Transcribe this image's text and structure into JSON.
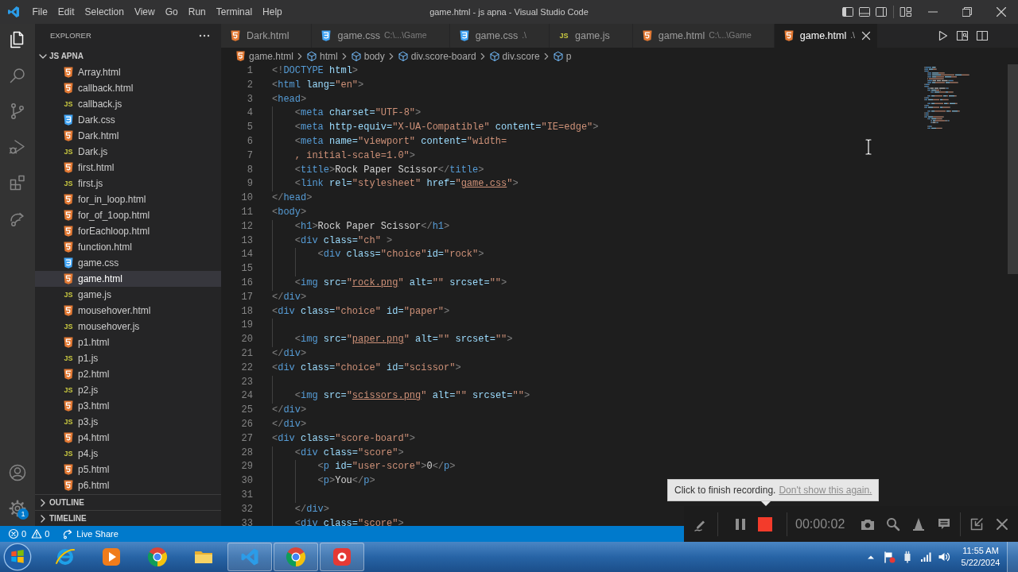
{
  "title_bar": {
    "menu": [
      "File",
      "Edit",
      "Selection",
      "View",
      "Go",
      "Run",
      "Terminal",
      "Help"
    ],
    "title": "game.html - js apna - Visual Studio Code"
  },
  "activity_bar": {
    "items": [
      {
        "kind": "explorer",
        "selected": true
      },
      {
        "kind": "search",
        "selected": false
      },
      {
        "kind": "source_control",
        "selected": false
      },
      {
        "kind": "run_debug",
        "selected": false
      },
      {
        "kind": "extensions",
        "selected": false
      },
      {
        "kind": "live_share",
        "selected": false
      }
    ],
    "bottom_items": [
      {
        "kind": "accounts"
      },
      {
        "kind": "manage",
        "badge": "1"
      }
    ]
  },
  "sidebar": {
    "title": "EXPLORER",
    "folder": {
      "name": "JS APNA",
      "expanded": true,
      "files": [
        {
          "kind": "html",
          "label": "Array.html",
          "selected": false
        },
        {
          "kind": "html",
          "label": "callback.html",
          "selected": false
        },
        {
          "kind": "js",
          "icon_text": "JS",
          "label": "callback.js",
          "selected": false
        },
        {
          "kind": "css",
          "label": "Dark.css",
          "selected": false
        },
        {
          "kind": "html",
          "label": "Dark.html",
          "selected": false
        },
        {
          "kind": "js",
          "icon_text": "JS",
          "label": "Dark.js",
          "selected": false
        },
        {
          "kind": "html",
          "label": "first.html",
          "selected": false
        },
        {
          "kind": "js",
          "icon_text": "JS",
          "label": "first.js",
          "selected": false
        },
        {
          "kind": "html",
          "label": "for_in_loop.html",
          "selected": false
        },
        {
          "kind": "html",
          "label": "for_of_1oop.html",
          "selected": false
        },
        {
          "kind": "html",
          "label": "forEachloop.html",
          "selected": false
        },
        {
          "kind": "html",
          "label": "function.html",
          "selected": false
        },
        {
          "kind": "css",
          "label": "game.css",
          "selected": false
        },
        {
          "kind": "html",
          "label": "game.html",
          "selected": true
        },
        {
          "kind": "js",
          "icon_text": "JS",
          "label": "game.js",
          "selected": false
        },
        {
          "kind": "html",
          "label": "mousehover.html",
          "selected": false
        },
        {
          "kind": "js",
          "icon_text": "JS",
          "label": "mousehover.js",
          "selected": false
        },
        {
          "kind": "html",
          "label": "p1.html",
          "selected": false
        },
        {
          "kind": "js",
          "icon_text": "JS",
          "label": "p1.js",
          "selected": false
        },
        {
          "kind": "html",
          "label": "p2.html",
          "selected": false
        },
        {
          "kind": "js",
          "icon_text": "JS",
          "label": "p2.js",
          "selected": false
        },
        {
          "kind": "html",
          "label": "p3.html",
          "selected": false
        },
        {
          "kind": "js",
          "icon_text": "JS",
          "label": "p3.js",
          "selected": false
        },
        {
          "kind": "html",
          "label": "p4.html",
          "selected": false
        },
        {
          "kind": "js",
          "icon_text": "JS",
          "label": "p4.js",
          "selected": false
        },
        {
          "kind": "html",
          "label": "p5.html",
          "selected": false
        },
        {
          "kind": "html",
          "label": "p6.html",
          "selected": false
        }
      ]
    },
    "panels": [
      {
        "name": "OUTLINE",
        "expanded": false
      },
      {
        "name": "TIMELINE",
        "expanded": false
      }
    ]
  },
  "tabs": [
    {
      "kind": "html",
      "label": "Dark.html",
      "selected": false
    },
    {
      "kind": "css",
      "label": "game.css",
      "description": "C:\\...\\Game",
      "selected": false
    },
    {
      "kind": "css",
      "label": "game.css",
      "description": ".\\",
      "selected": false
    },
    {
      "kind": "js",
      "icon_text": "JS",
      "label": "game.js",
      "selected": false
    },
    {
      "kind": "html",
      "label": "game.html",
      "description": "C:\\...\\Game",
      "selected": false
    },
    {
      "kind": "html",
      "label": "game.html",
      "description": ".\\",
      "selected": true
    }
  ],
  "breadcrumbs": [
    {
      "kind": "file",
      "label": "game.html"
    },
    {
      "kind": "element",
      "label": "html"
    },
    {
      "kind": "element",
      "label": "body"
    },
    {
      "kind": "element",
      "label": "div.score-board"
    },
    {
      "kind": "element",
      "label": "div.score"
    },
    {
      "kind": "element",
      "label": "p"
    }
  ],
  "editor": {
    "lines": [
      {
        "number": "1",
        "tokens": [
          {
            "kind": "bracket",
            "text": "<!"
          },
          {
            "kind": "tag",
            "text": "DOCTYPE"
          },
          {
            "kind": "attr",
            "text": " html"
          },
          {
            "kind": "bracket",
            "text": ">"
          }
        ]
      },
      {
        "number": "2",
        "tokens": [
          {
            "kind": "bracket",
            "text": "<"
          },
          {
            "kind": "tag",
            "text": "html"
          },
          {
            "kind": "attr",
            "text": " lang="
          },
          {
            "kind": "string",
            "text": "\"en\""
          },
          {
            "kind": "bracket",
            "text": ">"
          }
        ]
      },
      {
        "number": "3",
        "tokens": [
          {
            "kind": "bracket",
            "text": "<"
          },
          {
            "kind": "tag",
            "text": "head"
          },
          {
            "kind": "bracket",
            "text": ">"
          }
        ]
      },
      {
        "number": "4",
        "tokens": [
          {
            "kind": "bracket",
            "text": "    <"
          },
          {
            "kind": "tag",
            "text": "meta"
          },
          {
            "kind": "attr",
            "text": " charset="
          },
          {
            "kind": "string",
            "text": "\"UTF-8\""
          },
          {
            "kind": "bracket",
            "text": ">"
          }
        ]
      },
      {
        "number": "5",
        "tokens": [
          {
            "kind": "bracket",
            "text": "    <"
          },
          {
            "kind": "tag",
            "text": "meta"
          },
          {
            "kind": "attr",
            "text": " http-equiv="
          },
          {
            "kind": "string",
            "text": "\"X-UA-Compatible\""
          },
          {
            "kind": "attr",
            "text": " content="
          },
          {
            "kind": "string",
            "text": "\"IE=edge\""
          },
          {
            "kind": "bracket",
            "text": ">"
          }
        ]
      },
      {
        "number": "6",
        "tokens": [
          {
            "kind": "bracket",
            "text": "    <"
          },
          {
            "kind": "tag",
            "text": "meta"
          },
          {
            "kind": "attr",
            "text": " name="
          },
          {
            "kind": "string",
            "text": "\"viewport\""
          },
          {
            "kind": "attr",
            "text": " content="
          },
          {
            "kind": "string",
            "text": "\"width="
          }
        ]
      },
      {
        "number": "7",
        "tokens": [
          {
            "kind": "string",
            "text": "    , initial-scale=1.0\""
          },
          {
            "kind": "bracket",
            "text": ">"
          }
        ]
      },
      {
        "number": "8",
        "tokens": [
          {
            "kind": "bracket",
            "text": "    <"
          },
          {
            "kind": "tag",
            "text": "title"
          },
          {
            "kind": "bracket",
            "text": ">"
          },
          {
            "kind": "text",
            "text": "Rock Paper Scissor"
          },
          {
            "kind": "bracket",
            "text": "</"
          },
          {
            "kind": "tag",
            "text": "title"
          },
          {
            "kind": "bracket",
            "text": ">"
          }
        ]
      },
      {
        "number": "9",
        "tokens": [
          {
            "kind": "bracket",
            "text": "    <"
          },
          {
            "kind": "tag",
            "text": "link"
          },
          {
            "kind": "attr",
            "text": " rel="
          },
          {
            "kind": "string",
            "text": "\"stylesheet\""
          },
          {
            "kind": "attr",
            "text": " href="
          },
          {
            "kind": "string",
            "text": "\""
          },
          {
            "kind": "link",
            "text": "game.css"
          },
          {
            "kind": "string",
            "text": "\""
          },
          {
            "kind": "bracket",
            "text": ">"
          }
        ]
      },
      {
        "number": "10",
        "tokens": [
          {
            "kind": "bracket",
            "text": "</"
          },
          {
            "kind": "tag",
            "text": "head"
          },
          {
            "kind": "bracket",
            "text": ">"
          }
        ]
      },
      {
        "number": "11",
        "tokens": [
          {
            "kind": "bracket",
            "text": "<"
          },
          {
            "kind": "tag",
            "text": "body"
          },
          {
            "kind": "bracket",
            "text": ">"
          }
        ]
      },
      {
        "number": "12",
        "tokens": [
          {
            "kind": "bracket",
            "text": "    <"
          },
          {
            "kind": "tag",
            "text": "h1"
          },
          {
            "kind": "bracket",
            "text": ">"
          },
          {
            "kind": "text",
            "text": "Rock Paper Scissor"
          },
          {
            "kind": "bracket",
            "text": "</"
          },
          {
            "kind": "tag",
            "text": "h1"
          },
          {
            "kind": "bracket",
            "text": ">"
          }
        ]
      },
      {
        "number": "13",
        "tokens": [
          {
            "kind": "bracket",
            "text": "    <"
          },
          {
            "kind": "tag",
            "text": "div"
          },
          {
            "kind": "attr",
            "text": " class="
          },
          {
            "kind": "string",
            "text": "\"ch\""
          },
          {
            "kind": "bracket",
            "text": " >"
          }
        ]
      },
      {
        "number": "14",
        "tokens": [
          {
            "kind": "bracket",
            "text": "        <"
          },
          {
            "kind": "tag",
            "text": "div"
          },
          {
            "kind": "attr",
            "text": " class="
          },
          {
            "kind": "string",
            "text": "\"choice\""
          },
          {
            "kind": "attr",
            "text": "id="
          },
          {
            "kind": "string",
            "text": "\"rock\""
          },
          {
            "kind": "bracket",
            "text": ">"
          }
        ]
      },
      {
        "number": "15"
      },
      {
        "number": "16",
        "tokens": [
          {
            "kind": "bracket",
            "text": "    <"
          },
          {
            "kind": "tag",
            "text": "img"
          },
          {
            "kind": "attr",
            "text": " src="
          },
          {
            "kind": "string",
            "text": "\""
          },
          {
            "kind": "link",
            "text": "rock.png"
          },
          {
            "kind": "string",
            "text": "\""
          },
          {
            "kind": "attr",
            "text": " alt="
          },
          {
            "kind": "string",
            "text": "\"\""
          },
          {
            "kind": "attr",
            "text": " srcset="
          },
          {
            "kind": "string",
            "text": "\"\""
          },
          {
            "kind": "bracket",
            "text": ">"
          }
        ]
      },
      {
        "number": "17",
        "tokens": [
          {
            "kind": "bracket",
            "text": "</"
          },
          {
            "kind": "tag",
            "text": "div"
          },
          {
            "kind": "bracket",
            "text": ">"
          }
        ]
      },
      {
        "number": "18",
        "tokens": [
          {
            "kind": "bracket",
            "text": "<"
          },
          {
            "kind": "tag",
            "text": "div"
          },
          {
            "kind": "attr",
            "text": " class="
          },
          {
            "kind": "string",
            "text": "\"choice\""
          },
          {
            "kind": "attr",
            "text": " id="
          },
          {
            "kind": "string",
            "text": "\"paper\""
          },
          {
            "kind": "bracket",
            "text": ">"
          }
        ]
      },
      {
        "number": "19"
      },
      {
        "number": "20",
        "tokens": [
          {
            "kind": "bracket",
            "text": "    <"
          },
          {
            "kind": "tag",
            "text": "img"
          },
          {
            "kind": "attr",
            "text": " src="
          },
          {
            "kind": "string",
            "text": "\""
          },
          {
            "kind": "link",
            "text": "paper.png"
          },
          {
            "kind": "string",
            "text": "\""
          },
          {
            "kind": "attr",
            "text": " alt="
          },
          {
            "kind": "string",
            "text": "\"\""
          },
          {
            "kind": "attr",
            "text": " srcset="
          },
          {
            "kind": "string",
            "text": "\"\""
          },
          {
            "kind": "bracket",
            "text": ">"
          }
        ]
      },
      {
        "number": "21",
        "tokens": [
          {
            "kind": "bracket",
            "text": "</"
          },
          {
            "kind": "tag",
            "text": "div"
          },
          {
            "kind": "bracket",
            "text": ">"
          }
        ]
      },
      {
        "number": "22",
        "tokens": [
          {
            "kind": "bracket",
            "text": "<"
          },
          {
            "kind": "tag",
            "text": "div"
          },
          {
            "kind": "attr",
            "text": " class="
          },
          {
            "kind": "string",
            "text": "\"choice\""
          },
          {
            "kind": "attr",
            "text": " id="
          },
          {
            "kind": "string",
            "text": "\"scissor\""
          },
          {
            "kind": "bracket",
            "text": ">"
          }
        ]
      },
      {
        "number": "23"
      },
      {
        "number": "24",
        "tokens": [
          {
            "kind": "bracket",
            "text": "    <"
          },
          {
            "kind": "tag",
            "text": "img"
          },
          {
            "kind": "attr",
            "text": " src="
          },
          {
            "kind": "string",
            "text": "\""
          },
          {
            "kind": "link",
            "text": "scissors.png"
          },
          {
            "kind": "string",
            "text": "\""
          },
          {
            "kind": "attr",
            "text": " alt="
          },
          {
            "kind": "string",
            "text": "\"\""
          },
          {
            "kind": "attr",
            "text": " srcset="
          },
          {
            "kind": "string",
            "text": "\"\""
          },
          {
            "kind": "bracket",
            "text": ">"
          }
        ]
      },
      {
        "number": "25",
        "tokens": [
          {
            "kind": "bracket",
            "text": "</"
          },
          {
            "kind": "tag",
            "text": "div"
          },
          {
            "kind": "bracket",
            "text": ">"
          }
        ]
      },
      {
        "number": "26",
        "tokens": [
          {
            "kind": "bracket",
            "text": "</"
          },
          {
            "kind": "tag",
            "text": "div"
          },
          {
            "kind": "bracket",
            "text": ">"
          }
        ]
      },
      {
        "number": "27",
        "tokens": [
          {
            "kind": "bracket",
            "text": "<"
          },
          {
            "kind": "tag",
            "text": "div"
          },
          {
            "kind": "attr",
            "text": " class="
          },
          {
            "kind": "string",
            "text": "\"score-board\""
          },
          {
            "kind": "bracket",
            "text": ">"
          }
        ]
      },
      {
        "number": "28",
        "tokens": [
          {
            "kind": "bracket",
            "text": "    <"
          },
          {
            "kind": "tag",
            "text": "div"
          },
          {
            "kind": "attr",
            "text": " class="
          },
          {
            "kind": "string",
            "text": "\"score\""
          },
          {
            "kind": "bracket",
            "text": ">"
          }
        ]
      },
      {
        "number": "29",
        "tokens": [
          {
            "kind": "bracket",
            "text": "        <"
          },
          {
            "kind": "tag",
            "text": "p"
          },
          {
            "kind": "attr",
            "text": " id="
          },
          {
            "kind": "string",
            "text": "\"user-score\""
          },
          {
            "kind": "bracket",
            "text": ">"
          },
          {
            "kind": "text",
            "text": "0"
          },
          {
            "kind": "bracket",
            "text": "</"
          },
          {
            "kind": "tag",
            "text": "p"
          },
          {
            "kind": "bracket",
            "text": ">"
          }
        ]
      },
      {
        "number": "30",
        "tokens": [
          {
            "kind": "bracket",
            "text": "        <"
          },
          {
            "kind": "tag",
            "text": "p"
          },
          {
            "kind": "bracket",
            "text": ">"
          },
          {
            "kind": "text",
            "text": "You"
          },
          {
            "kind": "bracket",
            "text": "</"
          },
          {
            "kind": "tag",
            "text": "p"
          },
          {
            "kind": "bracket",
            "text": ">"
          }
        ]
      },
      {
        "number": "31"
      },
      {
        "number": "32",
        "tokens": [
          {
            "kind": "bracket",
            "text": "    </"
          },
          {
            "kind": "tag",
            "text": "div"
          },
          {
            "kind": "bracket",
            "text": ">"
          }
        ]
      },
      {
        "number": "33",
        "tokens": [
          {
            "kind": "bracket",
            "text": "    <"
          },
          {
            "kind": "tag",
            "text": "div"
          },
          {
            "kind": "attr",
            "text": " class="
          },
          {
            "kind": "string",
            "text": "\"score\""
          },
          {
            "kind": "bracket",
            "text": ">"
          }
        ]
      }
    ]
  },
  "status_bar": {
    "errors": "0",
    "warnings": "0",
    "live_share": "Live Share"
  },
  "recorder": {
    "tooltip": {
      "text": "Click to finish recording.",
      "link": "Don't show this again."
    },
    "timer": "00:00:02"
  },
  "taskbar": {
    "apps": [
      {
        "kind": "globe",
        "open": false
      },
      {
        "kind": "media",
        "open": false
      },
      {
        "kind": "wheel",
        "open": false
      },
      {
        "kind": "folder",
        "open": false
      },
      {
        "kind": "editor",
        "open": true
      },
      {
        "kind": "wheel",
        "open": true
      },
      {
        "kind": "recorder",
        "open": true
      }
    ],
    "clock": {
      "time": "11:55 AM",
      "date": "5/22/2024"
    }
  }
}
